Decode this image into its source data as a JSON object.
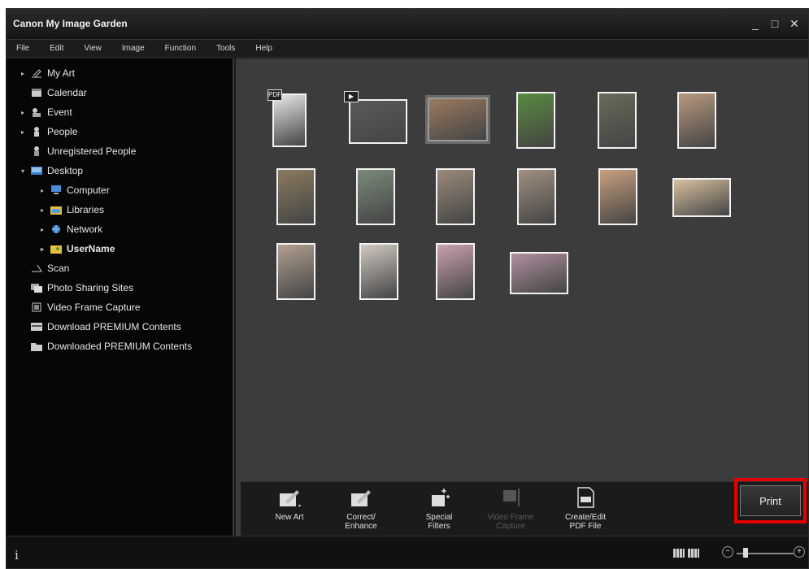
{
  "window": {
    "title": "Canon My Image Garden",
    "controls": [
      "_",
      "□",
      "✕"
    ]
  },
  "menu": [
    "File",
    "Edit",
    "View",
    "Image",
    "Function",
    "Tools",
    "Help"
  ],
  "sidebar": {
    "items": [
      {
        "label": "My Art",
        "icon": "my-art-icon",
        "expand": "▸"
      },
      {
        "label": "Calendar",
        "icon": "calendar-icon",
        "expand": ""
      },
      {
        "label": "Event",
        "icon": "event-icon",
        "expand": "▸"
      },
      {
        "label": "People",
        "icon": "people-icon",
        "expand": "▸"
      },
      {
        "label": "Unregistered People",
        "icon": "unregistered-people-icon",
        "expand": ""
      },
      {
        "label": "Desktop",
        "icon": "desktop-icon",
        "expand": "▾"
      },
      {
        "label": "Computer",
        "icon": "computer-icon",
        "expand": "▸"
      },
      {
        "label": "Libraries",
        "icon": "libraries-icon",
        "expand": "▸"
      },
      {
        "label": "Network",
        "icon": "network-icon",
        "expand": "▸"
      },
      {
        "label": "UserName",
        "icon": "user-folder-icon",
        "expand": "▸"
      },
      {
        "label": "Scan",
        "icon": "scan-icon",
        "expand": ""
      },
      {
        "label": "Photo Sharing Sites",
        "icon": "photo-sharing-icon",
        "expand": ""
      },
      {
        "label": "Video Frame Capture",
        "icon": "video-frame-icon",
        "expand": ""
      },
      {
        "label": "Download PREMIUM Contents",
        "icon": "download-icon",
        "expand": ""
      },
      {
        "label": "Downloaded PREMIUM Contents",
        "icon": "downloaded-folder-icon",
        "expand": ""
      }
    ]
  },
  "thumbnails": [
    {
      "color": "#e8e8e8",
      "badge": "PDF"
    },
    {
      "color": "#5a5a5a",
      "badge": "▶"
    },
    {
      "color": "#9a7a60"
    },
    {
      "color": "#5a8a40"
    },
    {
      "color": "#6a6a5a"
    },
    {
      "color": "#b89a80"
    },
    {
      "color": "#8a7a60"
    },
    {
      "color": "#7a8a7a"
    },
    {
      "color": "#9a8a7a"
    },
    {
      "color": "#a09080"
    },
    {
      "color": "#c8a080"
    },
    {
      "color": "#d8c0a0"
    },
    {
      "color": "#b0a090"
    },
    {
      "color": "#d0c8c0"
    },
    {
      "color": "#c8a0b0"
    },
    {
      "color": "#b090a0"
    }
  ],
  "toolbar": {
    "new_art": "New Art",
    "correct_line1": "Correct/",
    "correct_line2": "Enhance",
    "special_line1": "Special",
    "special_line2": "Filters",
    "video_line1": "Video Frame",
    "video_line2": "Capture",
    "pdf_line1": "Create/Edit",
    "pdf_line2": "PDF File",
    "print": "Print"
  },
  "status": {
    "info_symbol": "i",
    "zoom_minus": "−",
    "zoom_plus": "+"
  },
  "colors": {
    "accent_highlight": "#e40000",
    "background_dark": "#1a1a1a",
    "thumbnail_area": "#3c3c3c"
  }
}
